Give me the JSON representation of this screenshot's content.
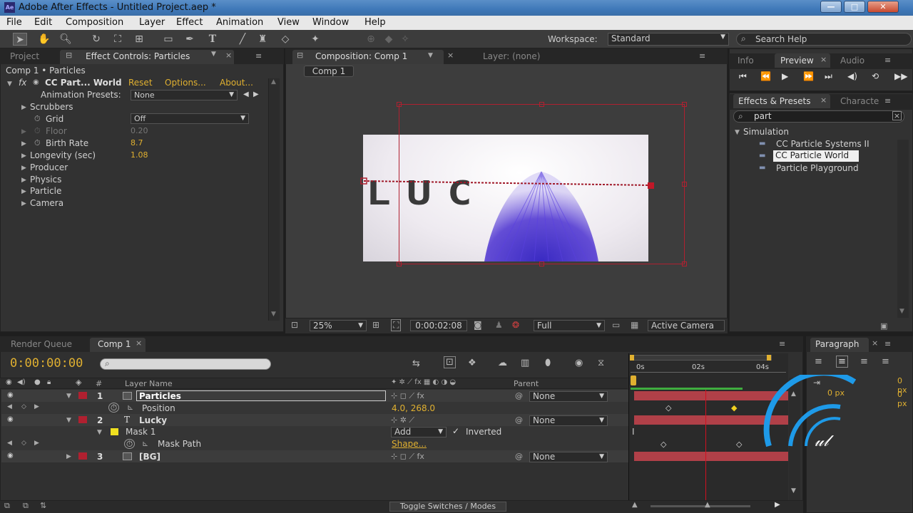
{
  "app": {
    "title": "Adobe After Effects - Untitled Project.aep *"
  },
  "window_buttons": {
    "min": "—",
    "max": "□",
    "close": "✕"
  },
  "menu": [
    "File",
    "Edit",
    "Composition",
    "Layer",
    "Effect",
    "Animation",
    "View",
    "Window",
    "Help"
  ],
  "workspace": {
    "label": "Workspace:",
    "value": "Standard"
  },
  "search_help": {
    "placeholder": "Search Help"
  },
  "project_panel": {
    "tabs": [
      "Project",
      "Effect Controls: Particles"
    ],
    "breadcrumb": "Comp 1 • Particles",
    "effect_name": "CC Part... World",
    "reset": "Reset",
    "options": "Options...",
    "about": "About...",
    "presets_label": "Animation Presets:",
    "presets_value": "None",
    "props": [
      {
        "label": "Scrubbers",
        "value": ""
      },
      {
        "label": "Grid",
        "value": "Off"
      },
      {
        "label": "Floor",
        "value": "0.20"
      },
      {
        "label": "Birth Rate",
        "value": "8.7"
      },
      {
        "label": "Longevity (sec)",
        "value": "1.08"
      },
      {
        "label": "Producer",
        "value": ""
      },
      {
        "label": "Physics",
        "value": ""
      },
      {
        "label": "Particle",
        "value": ""
      },
      {
        "label": "Camera",
        "value": ""
      }
    ]
  },
  "comp_panel": {
    "tabs": [
      "Composition: Comp 1",
      "Layer: (none)"
    ],
    "subtab": "Comp 1",
    "zoom": "25%",
    "timecode": "0:00:02:08",
    "resolution": "Full",
    "camera": "Active Camera",
    "canvas_text": "LUC"
  },
  "preview_panel": {
    "tabs": [
      "Info",
      "Preview",
      "Audio"
    ]
  },
  "effects_panel": {
    "tabs": [
      "Effects & Presets",
      "Characte"
    ],
    "search_value": "part",
    "category": "Simulation",
    "items": [
      "CC Particle Systems II",
      "CC Particle World",
      "Particle Playground"
    ]
  },
  "timeline": {
    "tabs": [
      "Render Queue",
      "Comp 1"
    ],
    "timecode": "0:00:00:00",
    "col_num": "#",
    "col_layer": "Layer Name",
    "col_parent": "Parent",
    "ruler": [
      "0s",
      "02s",
      "04s"
    ],
    "layers": [
      {
        "num": "1",
        "name": "Particles",
        "parent": "None",
        "color": "#b02030"
      },
      {
        "num": "",
        "name": "Position",
        "value": "4.0, 268.0"
      },
      {
        "num": "2",
        "name": "Lucky",
        "parent": "None",
        "color": "#b02030"
      },
      {
        "num": "",
        "name": "Mask 1",
        "mode": "Add",
        "inverted": "Inverted",
        "color": "#f0e020"
      },
      {
        "num": "",
        "name": "Mask Path",
        "value": "Shape..."
      },
      {
        "num": "3",
        "name": "[BG]",
        "parent": "None",
        "color": "#b02030"
      }
    ],
    "toggle_label": "Toggle Switches / Modes"
  },
  "paragraph_panel": {
    "tab": "Paragraph",
    "px1": "0 px",
    "px2": "0 px",
    "px3": "0 px"
  },
  "colors": {
    "accent": "#e0b030",
    "layer_bar": "#b04048",
    "playhead": "#d01020"
  }
}
